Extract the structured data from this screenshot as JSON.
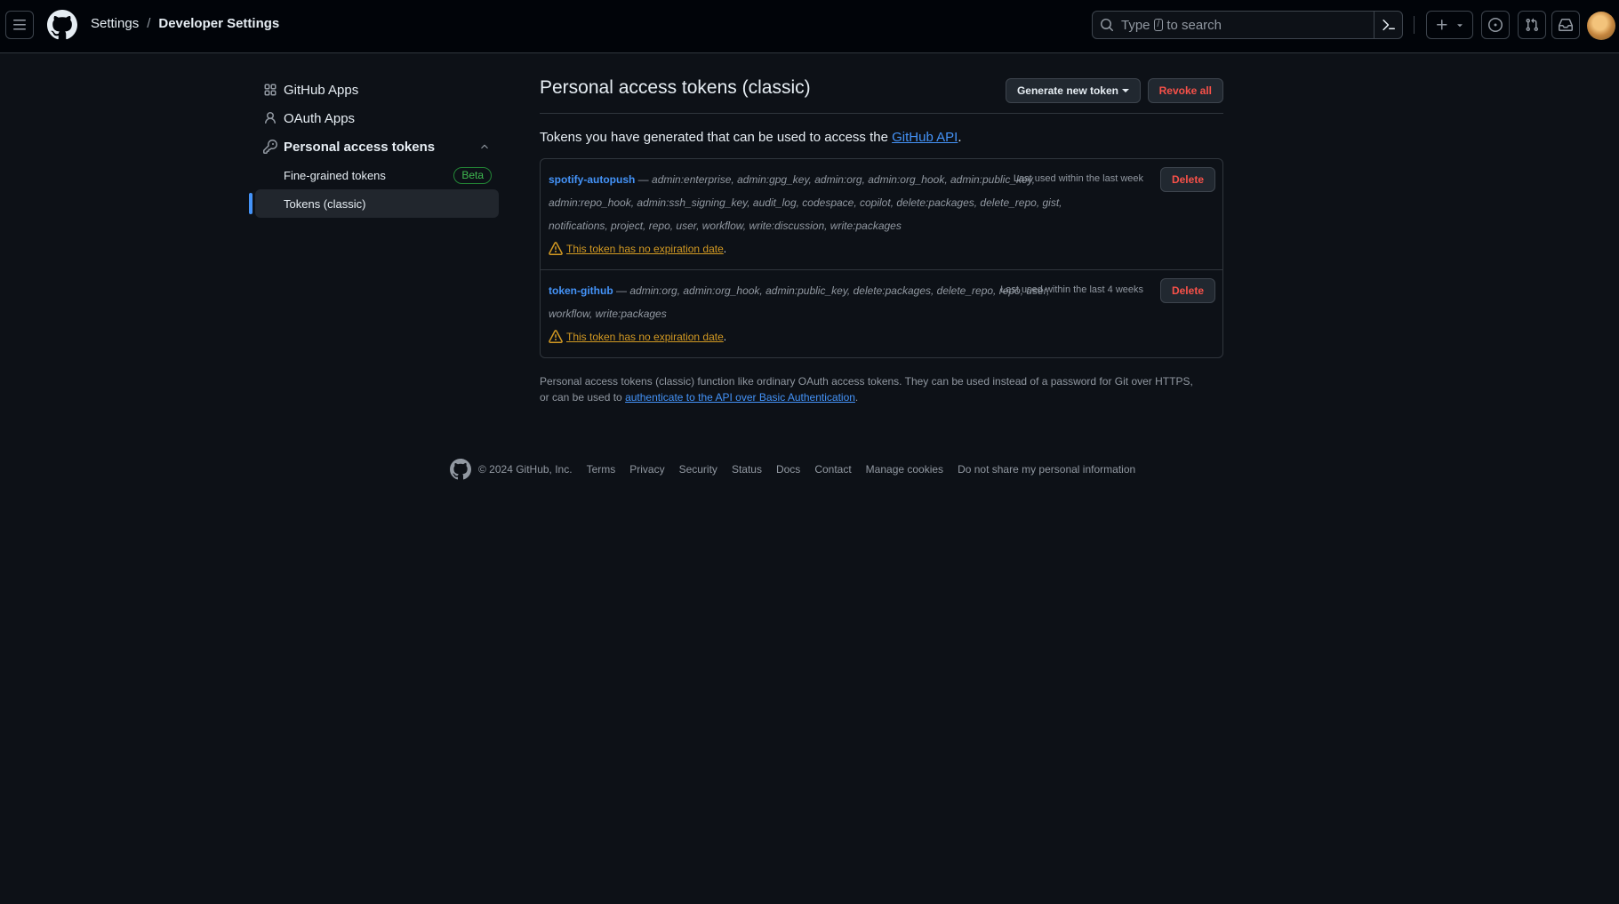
{
  "header": {
    "breadcrumb": [
      "Settings",
      "Developer Settings"
    ],
    "search_prefix": "Type",
    "search_key": "/",
    "search_suffix": "to search",
    "icons": [
      "hamburger-icon",
      "github-logo-icon",
      "search-icon",
      "command-palette-icon",
      "plus-icon",
      "triangle-down-icon",
      "issue-icon",
      "pull-request-icon",
      "inbox-icon",
      "avatar"
    ]
  },
  "sidebar": {
    "items": [
      {
        "label": "GitHub Apps",
        "icon": "apps-icon"
      },
      {
        "label": "OAuth Apps",
        "icon": "person-icon"
      },
      {
        "label": "Personal access tokens",
        "icon": "key-icon"
      }
    ],
    "subitems": [
      {
        "label": "Fine-grained tokens",
        "badge": "Beta"
      },
      {
        "label": "Tokens (classic)",
        "active": true
      }
    ]
  },
  "main": {
    "title": "Personal access tokens (classic)",
    "generate_label": "Generate new token",
    "revoke_label": "Revoke all",
    "intro_text": "Tokens you have generated that can be used to access the",
    "intro_link": "GitHub API",
    "intro_end": ".",
    "tokens": [
      {
        "name": "spotify-autopush",
        "scopes": "admin:enterprise, admin:gpg_key, admin:org, admin:org_hook, admin:public_key, admin:repo_hook, admin:ssh_signing_key, audit_log, codespace, copilot, delete:packages, delete_repo, gist, notifications, project, repo, user, workflow, write:discussion, write:packages",
        "last_used": "Last used within the last week",
        "warning": "This token has no expiration date",
        "delete_label": "Delete"
      },
      {
        "name": "token-github",
        "scopes": "admin:org, admin:org_hook, admin:public_key, delete:packages, delete_repo, repo, user, workflow, write:packages",
        "last_used": "Last used within the last 4 weeks",
        "warning": "This token has no expiration date",
        "delete_label": "Delete"
      }
    ],
    "dash": "—",
    "period": ".",
    "footnote_text": "Personal access tokens (classic) function like ordinary OAuth access tokens. They can be used instead of a password for Git over HTTPS, or can be used to",
    "footnote_link": "authenticate to the API over Basic Authentication",
    "footnote_end": "."
  },
  "footer": {
    "copyright": "© 2024 GitHub, Inc.",
    "links": [
      "Terms",
      "Privacy",
      "Security",
      "Status",
      "Docs",
      "Contact",
      "Manage cookies",
      "Do not share my personal information"
    ]
  },
  "colors": {
    "background": "#0d1117",
    "header_bg": "#010409",
    "accent_blue": "#4493f8",
    "danger": "#f85149",
    "warning": "#d29922",
    "success": "#3fb950"
  }
}
